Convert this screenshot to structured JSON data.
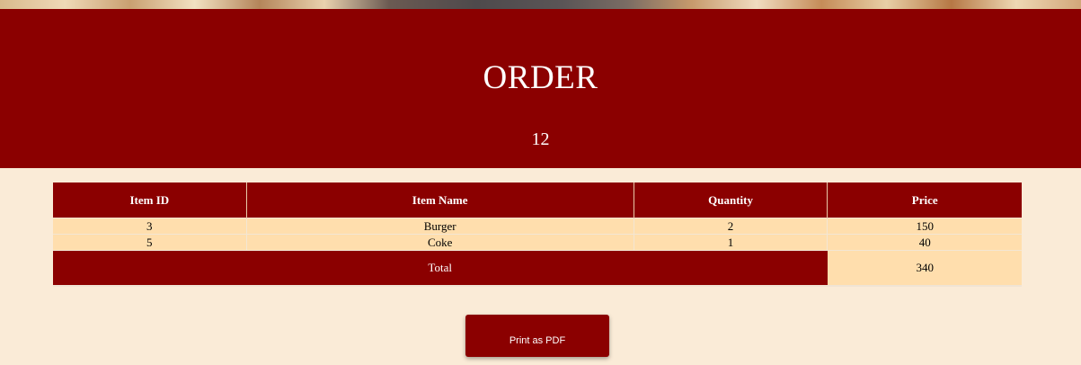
{
  "header": {
    "title": "ORDER",
    "order_number": "12"
  },
  "table": {
    "columns": [
      "Item ID",
      "Item Name",
      "Quantity",
      "Price"
    ],
    "rows": [
      {
        "item_id": "3",
        "item_name": "Burger",
        "quantity": "2",
        "price": "150"
      },
      {
        "item_id": "5",
        "item_name": "Coke",
        "quantity": "1",
        "price": "40"
      }
    ],
    "total_label": "Total",
    "total_value": "340"
  },
  "actions": {
    "print_label": "Print as PDF"
  },
  "colors": {
    "primary": "#8b0000",
    "page_background": "#faebd7",
    "cell_background": "#ffdead"
  }
}
